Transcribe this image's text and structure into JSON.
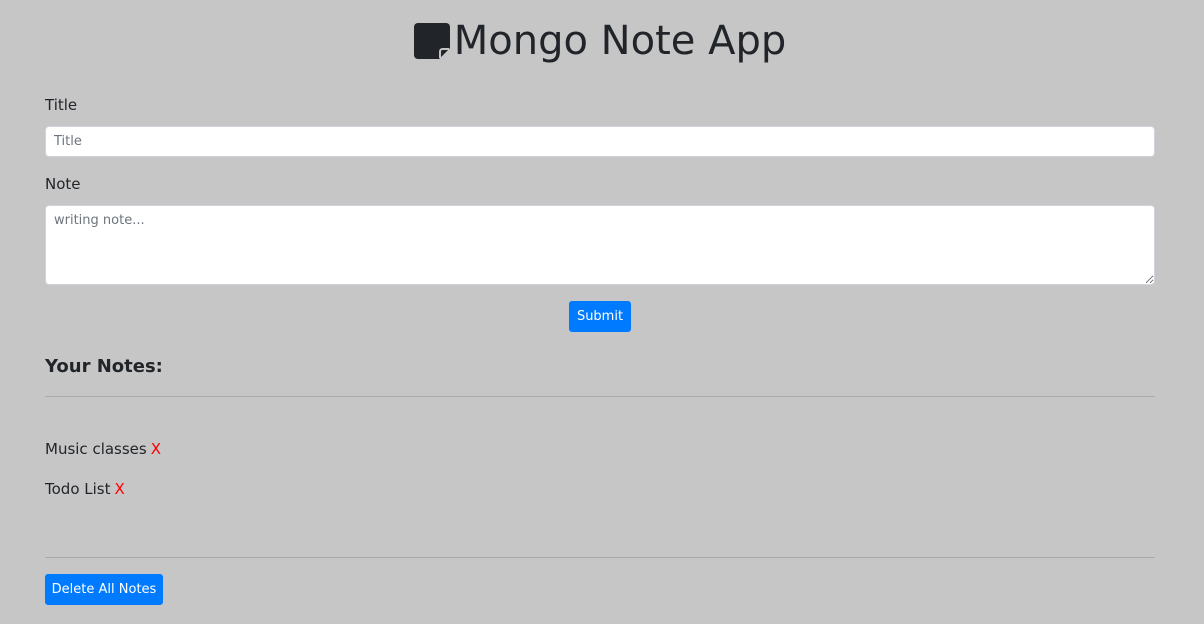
{
  "header": {
    "title": "Mongo Note App",
    "icon": "sticky-note-icon"
  },
  "form": {
    "title_label": "Title",
    "title_placeholder": "Title",
    "title_value": "",
    "note_label": "Note",
    "note_placeholder": "writing note...",
    "note_value": "",
    "submit_label": "Submit"
  },
  "notes": {
    "heading": "Your Notes:",
    "items": [
      {
        "title": "Music classes",
        "delete_label": "X"
      },
      {
        "title": "Todo List",
        "delete_label": "X"
      }
    ],
    "delete_all_label": "Delete All Notes"
  },
  "colors": {
    "background": "#c6c6c6",
    "primary": "#007bff",
    "delete": "#ff0000",
    "text": "#212529"
  }
}
